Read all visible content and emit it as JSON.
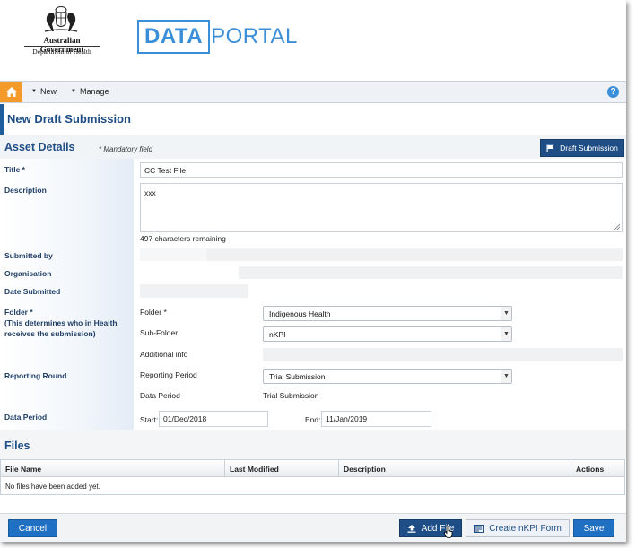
{
  "header": {
    "gov_name": "Australian Government",
    "gov_dept": "Department of Health",
    "portal_logo_box": "DATA",
    "portal_logo_rest": "PORTAL"
  },
  "toolbar": {
    "home_icon": "home-icon",
    "new_label": "New",
    "manage_label": "Manage",
    "help_icon": "help-icon",
    "accent_color": "#f39a2a"
  },
  "page": {
    "title": "New Draft Submission"
  },
  "asset_details": {
    "section_title": "Asset Details",
    "mandatory_note": "* Mandatory field",
    "draft_button": "Draft Submission",
    "title_label": "Title *",
    "title_value": "CC Test File",
    "description_label": "Description",
    "description_value": "xxx",
    "chars_remaining": "497 characters remaining",
    "submitted_by_label": "Submitted by",
    "organisation_label": "Organisation",
    "date_submitted_label": "Date Submitted",
    "folder_label": "Folder *",
    "folder_hint": "(This determines who in Health receives the submission)",
    "folder_field_label": "Folder *",
    "folder_value": "Indigenous Health",
    "subfolder_label": "Sub-Folder",
    "subfolder_value": "nKPI",
    "additional_info_label": "Additional info",
    "reporting_round_label": "Reporting Round",
    "reporting_period_label": "Reporting Period",
    "reporting_period_value": "Trial Submission",
    "data_period_inner_label": "Data Period",
    "data_period_inner_value": "Trial Submission",
    "data_period_label": "Data Period",
    "start_label": "Start:",
    "start_value": "01/Dec/2018",
    "end_label": "End:",
    "end_value": "11/Jan/2019"
  },
  "files": {
    "section_title": "Files",
    "columns": [
      "File Name",
      "Last Modified",
      "Description",
      "Actions"
    ],
    "empty_message": "No files have been added yet."
  },
  "footer": {
    "cancel_label": "Cancel",
    "add_file_label": "Add File",
    "create_form_label": "Create nKPI Form",
    "save_label": "Save"
  }
}
